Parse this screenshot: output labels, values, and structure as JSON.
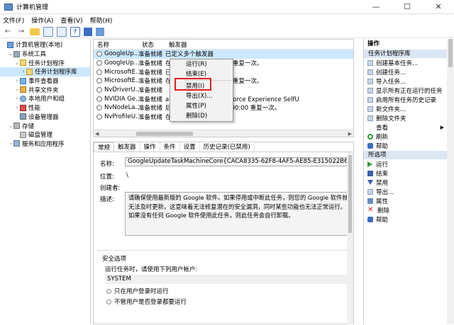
{
  "window": {
    "title": "计算机管理"
  },
  "menu": [
    "文件(F)",
    "操作(A)",
    "查看(V)",
    "帮助(H)"
  ],
  "tree": [
    {
      "label": "计算机管理(本地)",
      "level": 0,
      "icon": "computer-icon",
      "arrow": ""
    },
    {
      "label": "系统工具",
      "level": 1,
      "icon": "tools-icon",
      "arrow": "⌄"
    },
    {
      "label": "任务计划程序",
      "level": 2,
      "icon": "task-scheduler-icon",
      "arrow": "⌄"
    },
    {
      "label": "任务计划程序库",
      "level": 3,
      "icon": "task-library-icon",
      "arrow": "›",
      "selected": true
    },
    {
      "label": "事件查看器",
      "level": 2,
      "icon": "event-viewer-icon",
      "arrow": "›"
    },
    {
      "label": "共享文件夹",
      "level": 2,
      "icon": "shared-folder-icon",
      "arrow": "›"
    },
    {
      "label": "本地用户和组",
      "level": 2,
      "icon": "users-icon",
      "arrow": "›"
    },
    {
      "label": "性能",
      "level": 2,
      "icon": "performance-icon",
      "arrow": "›"
    },
    {
      "label": "设备管理器",
      "level": 2,
      "icon": "device-manager-icon",
      "arrow": ""
    },
    {
      "label": "存储",
      "level": 1,
      "icon": "storage-icon",
      "arrow": "⌄"
    },
    {
      "label": "磁盘管理",
      "level": 2,
      "icon": "disk-icon",
      "arrow": ""
    },
    {
      "label": "服务和应用程序",
      "level": 1,
      "icon": "services-icon",
      "arrow": "›"
    }
  ],
  "task_list": {
    "columns": [
      "名称",
      "状态",
      "触发器"
    ],
    "rows": [
      {
        "name": "GoogleUp...",
        "status": "准备就绪",
        "trigger": "已定义多个触发器",
        "selected": true
      },
      {
        "name": "GoogleUp...",
        "status": "准备就绪",
        "trigger": "在 1 天 期间每隔 1 小时 重复一次。"
      },
      {
        "name": "MicrosoftE...",
        "status": "准备就绪",
        "trigger": "已定义多个触发器"
      },
      {
        "name": "MicrosoftE...",
        "status": "准备就绪",
        "trigger": "在 1 天 期间每隔 1 小时 重复一次。"
      },
      {
        "name": "NvDriverU...",
        "status": "准备就绪",
        "trigger": ""
      },
      {
        "name": "NVIDIA Ge...",
        "status": "准备就绪",
        "trigger": "ation, 启动 NVIDIA GeForce Experience SelfU"
      },
      {
        "name": "NvNodeLa...",
        "status": "准备就绪",
        "trigger": "后，无限期地每隔 1.00:00:00 重复一次。"
      },
      {
        "name": "NvProfileU...",
        "status": "准备就绪",
        "trigger": "在每天的 12:25"
      }
    ]
  },
  "context_menu": [
    "运行(R)",
    "结束(E)",
    "禁用(I)",
    "导出(X)...",
    "属性(P)",
    "删除(D)"
  ],
  "detail_tabs": [
    "常规",
    "触发器",
    "操作",
    "条件",
    "设置",
    "历史记录(已禁用)"
  ],
  "general": {
    "name_label": "名称:",
    "name_value": "GoogleUpdateTaskMachineCore{CACA8335-62F8-4AF5-AE85-E315022B6BDA}",
    "location_label": "位置:",
    "location_value": "\\",
    "author_label": "创建者:",
    "desc_label": "描述:",
    "desc_value": "请确保使用最新版的 Google 软件。如果停用或中断此任务，则您的 Google 软件就无法及时更新，这意味着无法修复潜在的安全漏洞，同时某些功能也无法正常运行。如果没有任何 Google 软件使用此任务，则此任务会自行卸载。",
    "security_title": "安全选项",
    "run_as_label": "运行任务时，请使用下列用户帐户:",
    "run_as_value": "SYSTEM",
    "radio_1": "只在用户登录时运行",
    "radio_2": "不管用户是否登录都要运行"
  },
  "actions": {
    "header": "操作",
    "section1": "任务计划程序库",
    "items1": [
      {
        "label": "创建基本任务...",
        "icon": "create-basic-icon"
      },
      {
        "label": "创建任务...",
        "icon": "create-task-icon"
      },
      {
        "label": "导入任务...",
        "icon": "import-icon"
      },
      {
        "label": "显示所有正在运行的任务",
        "icon": "running-tasks-icon"
      },
      {
        "label": "启用所有任务历史记录",
        "icon": "history-icon"
      },
      {
        "label": "新文件夹...",
        "icon": "new-folder-icon"
      },
      {
        "label": "删除文件夹",
        "icon": "delete-folder-icon"
      },
      {
        "label": "查看",
        "icon": "view-icon",
        "submenu": true
      },
      {
        "label": "刷新",
        "icon": "refresh-icon"
      },
      {
        "label": "帮助",
        "icon": "help-icon"
      }
    ],
    "section2": "所选项",
    "items2": [
      {
        "label": "运行",
        "icon": "run-icon"
      },
      {
        "label": "结束",
        "icon": "stop-icon"
      },
      {
        "label": "禁用",
        "icon": "disable-icon"
      },
      {
        "label": "导出...",
        "icon": "export-icon"
      },
      {
        "label": "属性",
        "icon": "properties-icon"
      },
      {
        "label": "删除",
        "icon": "delete-icon"
      },
      {
        "label": "帮助",
        "icon": "help-icon"
      }
    ]
  }
}
